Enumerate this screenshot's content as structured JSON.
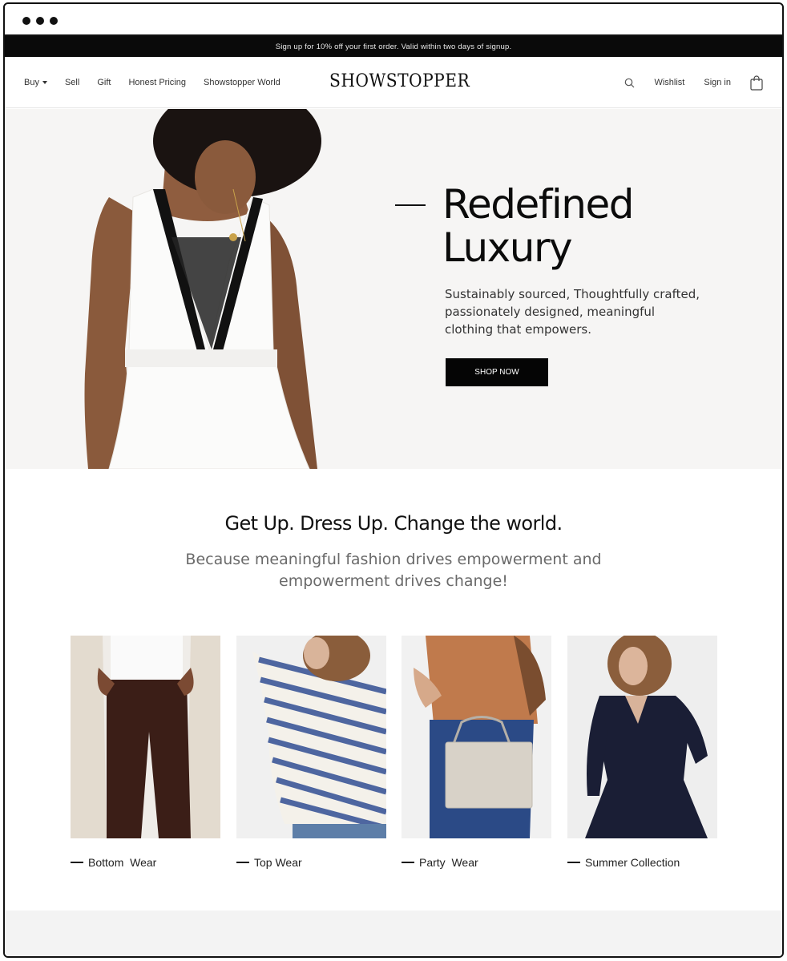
{
  "announcement": "Sign up for 10% off your first order. Valid within two days of signup.",
  "nav": {
    "left": [
      {
        "label": "Buy"
      },
      {
        "label": "Sell"
      },
      {
        "label": "Gift"
      },
      {
        "label": "Honest Pricing"
      },
      {
        "label": "Showstopper World"
      }
    ],
    "logo": "SHOWSTOPPER",
    "wishlist": "Wishlist",
    "signin": "Sign in"
  },
  "hero": {
    "title_line1": "Redefined",
    "title_line2": "Luxury",
    "subtitle": "Sustainably sourced, Thoughtfully crafted, passionately designed, meaningful clothing that empowers.",
    "button": "SHOP NOW"
  },
  "tagline": {
    "title": "Get Up. Dress Up. Change the world.",
    "subtitle_line1": "Because meaningful fashion drives empowerment and",
    "subtitle_line2": "empowerment drives change!"
  },
  "categories": [
    {
      "label": "Bottom  Wear"
    },
    {
      "label": "Top Wear"
    },
    {
      "label": "Party  Wear"
    },
    {
      "label": "Summer Collection"
    }
  ],
  "colors": {
    "accent": "#050505",
    "hero_bg": "#f6f5f4",
    "logo_star": "#c9a24a"
  }
}
